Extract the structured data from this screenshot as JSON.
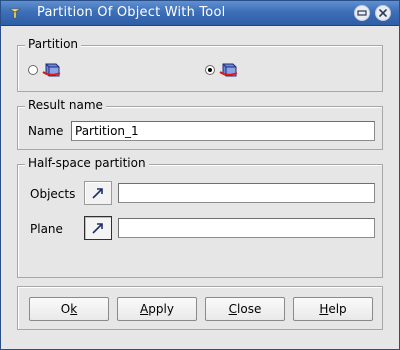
{
  "window": {
    "title": "Partition Of Object With Tool"
  },
  "partition": {
    "legend": "Partition",
    "options": [
      {
        "icon": "partition-shape-icon",
        "selected": false
      },
      {
        "icon": "partition-plane-shape-icon",
        "selected": true
      }
    ]
  },
  "result_name": {
    "legend": "Result name",
    "name_label": "Name",
    "name_value": "Partition_1"
  },
  "half_space": {
    "legend": "Half-space partition",
    "objects_label": "Objects",
    "objects_value": "",
    "plane_label": "Plane",
    "plane_value": ""
  },
  "buttons": {
    "ok": {
      "before": "O",
      "mnemonic": "k",
      "after": ""
    },
    "apply": {
      "before": "",
      "mnemonic": "A",
      "after": "pply"
    },
    "close": {
      "before": "",
      "mnemonic": "C",
      "after": "lose"
    },
    "help": {
      "before": "",
      "mnemonic": "H",
      "after": "elp"
    }
  },
  "icons": {
    "titlebar": "app-menu-icon",
    "minimize": "minimize-icon",
    "close": "close-icon",
    "select": "select-arrow-icon"
  }
}
